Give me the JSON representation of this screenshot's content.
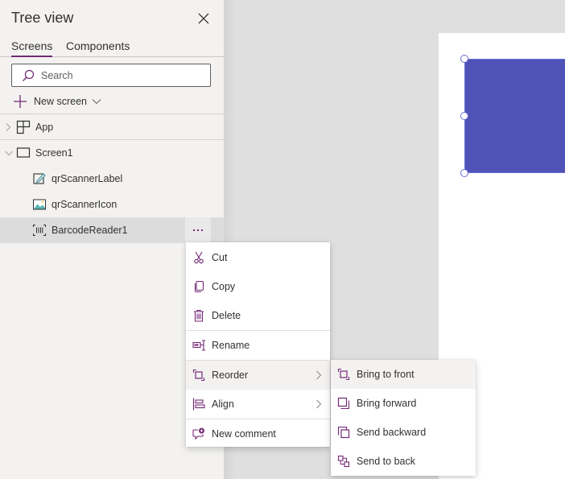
{
  "panel": {
    "title": "Tree view",
    "close_icon": "close-icon",
    "tabs": [
      {
        "label": "Screens",
        "active": true
      },
      {
        "label": "Components",
        "active": false
      }
    ],
    "search": {
      "placeholder": "Search",
      "value": ""
    },
    "new_screen_label": "New screen"
  },
  "tree": {
    "items": [
      {
        "label": "App",
        "icon": "app-grid-icon",
        "expanded": false,
        "level": 0
      },
      {
        "label": "Screen1",
        "icon": "screen-icon",
        "expanded": true,
        "level": 0
      },
      {
        "label": "qrScannerLabel",
        "icon": "label-edit-icon",
        "level": 1
      },
      {
        "label": "qrScannerIcon",
        "icon": "image-icon",
        "level": 1
      },
      {
        "label": "BarcodeReader1",
        "icon": "barcode-icon",
        "level": 1,
        "selected": true
      }
    ],
    "more_options_label": "..."
  },
  "context_menu": {
    "items": [
      {
        "label": "Cut",
        "icon": "scissors-icon"
      },
      {
        "label": "Copy",
        "icon": "copy-icon"
      },
      {
        "label": "Delete",
        "icon": "trash-icon"
      },
      {
        "label": "Rename",
        "icon": "rename-icon"
      },
      {
        "label": "Reorder",
        "icon": "reorder-icon",
        "submenu": true,
        "hovered": true
      },
      {
        "label": "Align",
        "icon": "align-icon",
        "submenu": true
      },
      {
        "label": "New comment",
        "icon": "comment-add-icon"
      }
    ]
  },
  "reorder_submenu": {
    "items": [
      {
        "label": "Bring to front",
        "icon": "bring-to-front-icon",
        "hovered": true
      },
      {
        "label": "Bring forward",
        "icon": "bring-forward-icon"
      },
      {
        "label": "Send backward",
        "icon": "send-backward-icon"
      },
      {
        "label": "Send to back",
        "icon": "send-to-back-icon"
      }
    ]
  },
  "canvas": {
    "control_color": "#4f52b7"
  },
  "colors": {
    "accent": "#742774",
    "panel_bg": "#f3f2f1",
    "canvas_bg": "#dfdfdf",
    "selected_row": "#dcdcdc"
  }
}
